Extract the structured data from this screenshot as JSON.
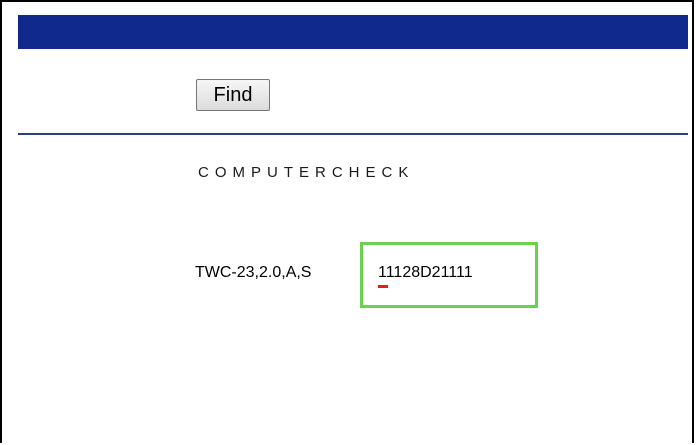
{
  "header": {
    "bar_color": "#0f2a8c"
  },
  "toolbar": {
    "find_label": "Find"
  },
  "main": {
    "brand_title": "COMPUTERCHECK",
    "spec_label": "TWC-23,2.0,A,S",
    "code_value": "11128D21111",
    "highlight_color": "#6cd04f",
    "underline_color": "#e0201b"
  }
}
